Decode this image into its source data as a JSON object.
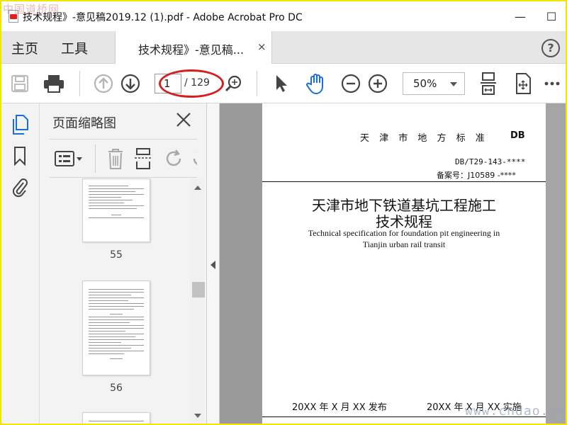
{
  "watermark_top": "中国道桥网",
  "watermark_bottom": "www.cndao.com",
  "window": {
    "title": "技术规程》-意见稿2019.12 (1).pdf - Adobe Acrobat Pro DC",
    "minimize": "—",
    "maximize": "☐"
  },
  "tabs": {
    "home": "主页",
    "tools": "工具",
    "document": "技术规程》-意见稿...",
    "close": "×",
    "help": "?"
  },
  "toolbar": {
    "current_page": "1",
    "total_pages": "/ 129",
    "zoom": "50%"
  },
  "panel": {
    "title": "页面缩略图",
    "thumbnails": [
      {
        "page": "55"
      },
      {
        "page": "56"
      }
    ]
  },
  "document": {
    "standard": "天 津 市 地 方 标 准",
    "db": "DB",
    "code": "DB/T29-143-****",
    "registration": "备案号：J10589 -****",
    "title_line1": "天津市地下铁道基坑工程施工",
    "title_line2": "技术规程",
    "english_line1": "Technical specification for foundation pit engineering in",
    "english_line2": "Tianjin urban rail transit",
    "publish": "20XX 年 X 月 XX 发布",
    "implement": "20XX 年 X 月 XX 实施"
  },
  "colors": {
    "frame": "#f2e600",
    "accent_blue": "#1a6fd6",
    "annotation_red": "#d42020"
  }
}
